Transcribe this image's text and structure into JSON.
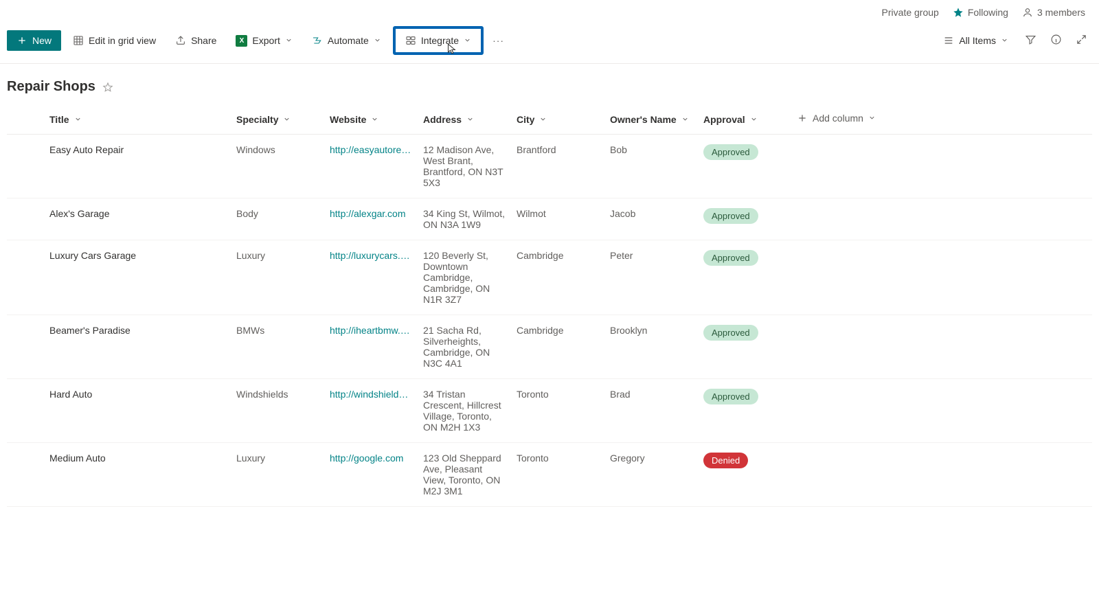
{
  "header": {
    "group_type": "Private group",
    "following": "Following",
    "members": "3 members"
  },
  "toolbar": {
    "new_label": "New",
    "edit_grid_label": "Edit in grid view",
    "share_label": "Share",
    "export_label": "Export",
    "automate_label": "Automate",
    "integrate_label": "Integrate",
    "view_label": "All Items"
  },
  "list": {
    "title": "Repair Shops"
  },
  "columns": {
    "title": "Title",
    "specialty": "Specialty",
    "website": "Website",
    "address": "Address",
    "city": "City",
    "owner": "Owner's Name",
    "approval": "Approval",
    "add": "Add column"
  },
  "rows": [
    {
      "title": "Easy Auto Repair",
      "specialty": "Windows",
      "website": "http://easyautorepair.c...",
      "address": "12 Madison Ave, West Brant, Brantford, ON N3T 5X3",
      "city": "Brantford",
      "owner": "Bob",
      "approval": "Approved",
      "approval_status": "approved"
    },
    {
      "title": "Alex's Garage",
      "specialty": "Body",
      "website": "http://alexgar.com",
      "address": "34 King St, Wilmot, ON N3A 1W9",
      "city": "Wilmot",
      "owner": "Jacob",
      "approval": "Approved",
      "approval_status": "approved"
    },
    {
      "title": "Luxury Cars Garage",
      "specialty": "Luxury",
      "website": "http://luxurycars.com",
      "address": "120 Beverly St, Downtown Cambridge, Cambridge, ON N1R 3Z7",
      "city": "Cambridge",
      "owner": "Peter",
      "approval": "Approved",
      "approval_status": "approved"
    },
    {
      "title": "Beamer's Paradise",
      "specialty": "BMWs",
      "website": "http://iheartbmw.com",
      "address": "21 Sacha Rd, Silverheights, Cambridge, ON N3C 4A1",
      "city": "Cambridge",
      "owner": "Brooklyn",
      "approval": "Approved",
      "approval_status": "approved"
    },
    {
      "title": "Hard Auto",
      "specialty": "Windshields",
      "website": "http://windshieldharda...",
      "address": "34 Tristan Crescent, Hillcrest Village, Toronto, ON M2H 1X3",
      "city": "Toronto",
      "owner": "Brad",
      "approval": "Approved",
      "approval_status": "approved"
    },
    {
      "title": "Medium Auto",
      "specialty": "Luxury",
      "website": "http://google.com",
      "address": "123 Old Sheppard Ave, Pleasant View, Toronto, ON M2J 3M1",
      "city": "Toronto",
      "owner": "Gregory",
      "approval": "Denied",
      "approval_status": "denied"
    }
  ]
}
